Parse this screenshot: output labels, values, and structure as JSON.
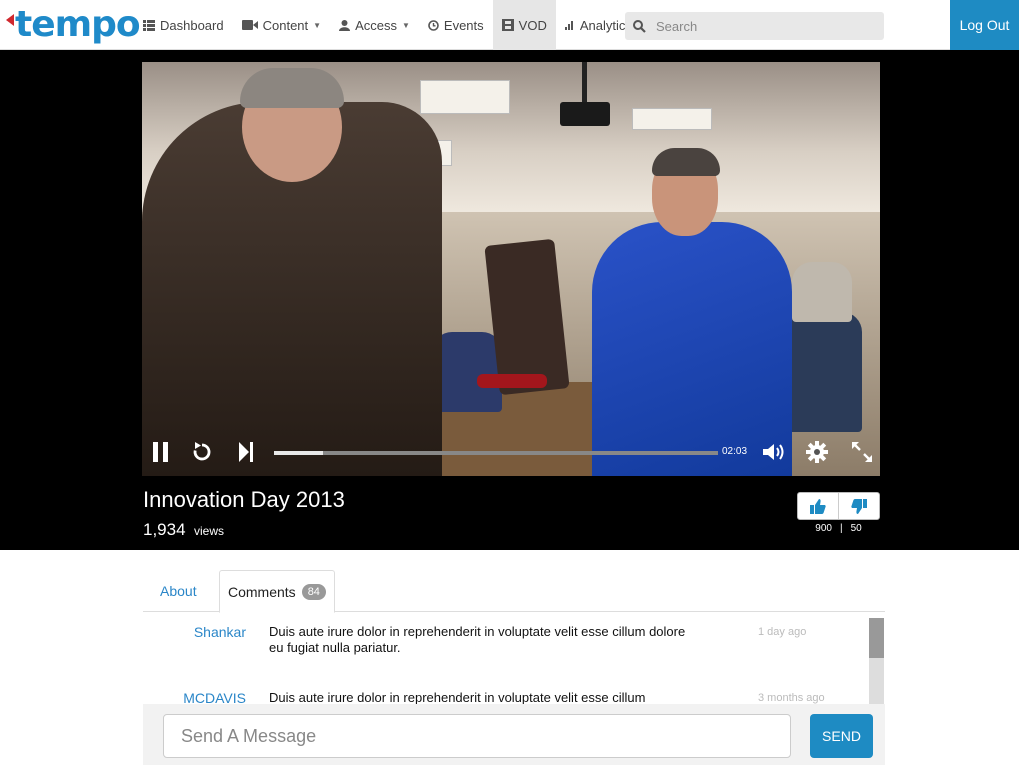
{
  "brand": {
    "logo_text": "tempo",
    "accent": "#1e8bc3",
    "logo_mark_color": "#d0282e"
  },
  "nav": {
    "items": [
      {
        "label": "Dashboard",
        "icon": "list-icon",
        "caret": false
      },
      {
        "label": "Content",
        "icon": "video-camera-icon",
        "caret": true
      },
      {
        "label": "Access",
        "icon": "user-icon",
        "caret": true
      },
      {
        "label": "Events",
        "icon": "clock-icon",
        "caret": false
      },
      {
        "label": "VOD",
        "icon": "film-icon",
        "caret": false,
        "active": true
      },
      {
        "label": "Analytics",
        "icon": "bar-chart-icon",
        "caret": true
      }
    ],
    "search_placeholder": "Search",
    "logout_label": "Log Out"
  },
  "player": {
    "time": "02:03",
    "progress": 0.11,
    "controls": [
      "pause-icon",
      "replay-icon",
      "skip-next-icon",
      "volume-icon",
      "settings-icon",
      "fullscreen-icon"
    ]
  },
  "video_info": {
    "title": "Innovation Day 2013",
    "views_count": "1,934",
    "views_label": "views",
    "likes": "900",
    "dislikes": "50",
    "separator": "|"
  },
  "tabs": {
    "about_label": "About",
    "comments_label": "Comments",
    "comments_count": "84"
  },
  "comments": [
    {
      "user": "Shankar",
      "text": "Duis aute irure dolor in reprehenderit in voluptate velit esse cillum dolore eu fugiat nulla pariatur.",
      "time": "1 day ago"
    },
    {
      "user": "MCDAVIS",
      "text": "Duis aute irure dolor in reprehenderit in voluptate velit esse cillum",
      "time": "3 months ago"
    }
  ],
  "composer": {
    "placeholder": "Send A Message",
    "send_label": "SEND"
  }
}
